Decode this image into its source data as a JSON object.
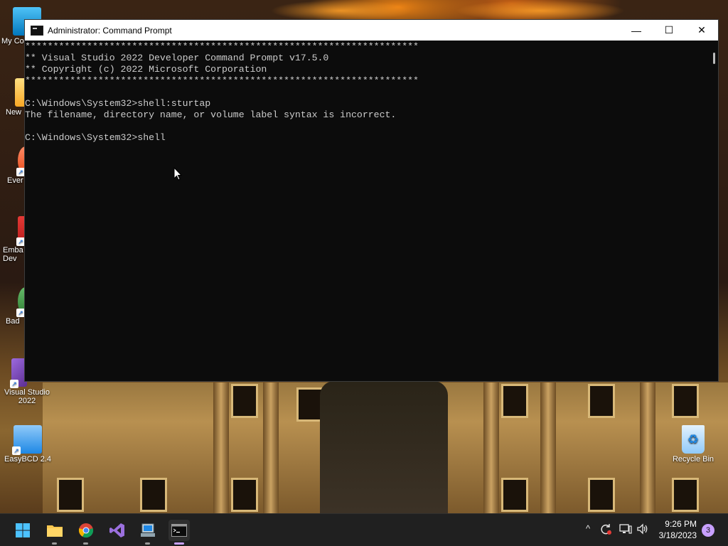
{
  "window": {
    "title": "Administrator:  Command Prompt",
    "minimize_glyph": "—",
    "maximize_glyph": "☐",
    "close_glyph": "✕"
  },
  "console": {
    "lines": [
      "**********************************************************************",
      "** Visual Studio 2022 Developer Command Prompt v17.5.0",
      "** Copyright (c) 2022 Microsoft Corporation",
      "**********************************************************************",
      "",
      "C:\\Windows\\System32>shell:sturtap",
      "The filename, directory name, or volume label syntax is incorrect.",
      "",
      "C:\\Windows\\System32>shell"
    ]
  },
  "desktop": {
    "icons": [
      {
        "label": "My Co",
        "icon": "computer-icon"
      },
      {
        "label": "New",
        "icon": "folder-icon"
      },
      {
        "label": "Ever",
        "icon": "app-icon"
      },
      {
        "label": "Emba\nDev",
        "icon": "app-icon"
      },
      {
        "label": "Bad",
        "icon": "game-icon"
      },
      {
        "label": "Visual Studio\n2022",
        "icon": "visual-studio-icon"
      },
      {
        "label": "EasyBCD 2.4",
        "icon": "easybcd-icon"
      },
      {
        "label": "Recycle Bin",
        "icon": "recycle-bin-icon"
      }
    ]
  },
  "taskbar": {
    "apps": [
      {
        "name": "start",
        "icon": "windows-start-icon"
      },
      {
        "name": "file-explorer",
        "icon": "folder-icon"
      },
      {
        "name": "chrome",
        "icon": "chrome-icon"
      },
      {
        "name": "visual-studio",
        "icon": "visual-studio-icon"
      },
      {
        "name": "easybcd",
        "icon": "easybcd-icon"
      },
      {
        "name": "command-prompt",
        "icon": "terminal-icon",
        "active": true
      }
    ],
    "tray": {
      "chevron": "^",
      "time": "9:26 PM",
      "date": "3/18/2023",
      "notification_count": "3"
    }
  },
  "colors": {
    "console_bg": "#0c0c0c",
    "console_fg": "#cccccc",
    "taskbar_bg": "#202020",
    "accent": "#c8a0ff"
  }
}
